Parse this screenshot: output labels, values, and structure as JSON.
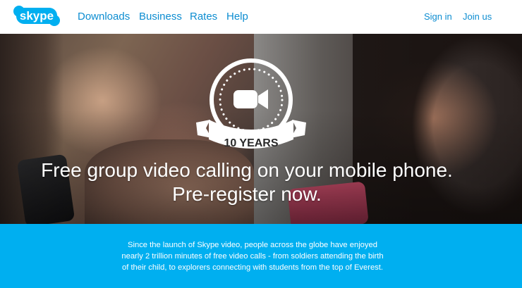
{
  "header": {
    "logo_text": "skype",
    "nav": [
      "Downloads",
      "Business",
      "Rates",
      "Help"
    ],
    "sign_in": "Sign in",
    "join_us": "Join us"
  },
  "hero": {
    "badge_text": "10 YEARS",
    "badge_icon": "video-camera-icon",
    "headline_line1": "Free group video calling on your mobile phone.",
    "headline_line2": "Pre-register now."
  },
  "info": {
    "text": "Since the launch of Skype video, people across the globe have enjoyed nearly 2 trillion minutes of free video calls - from soldiers attending the birth of their child, to explorers connecting with students from the top of Everest."
  },
  "colors": {
    "brand_blue": "#00aff0",
    "nav_blue": "#0d8dd1",
    "white": "#ffffff"
  }
}
